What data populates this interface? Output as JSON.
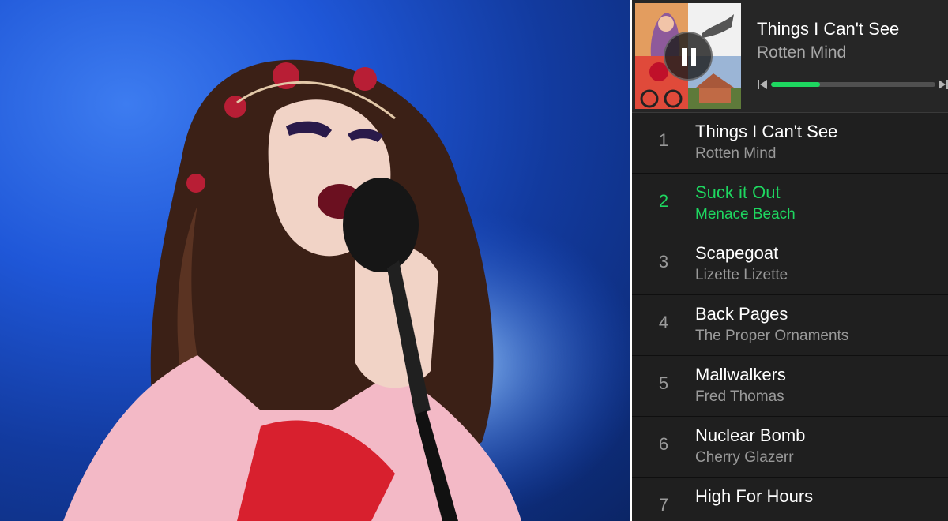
{
  "player": {
    "now_playing": {
      "title": "Things I Can't See",
      "artist": "Rotten Mind"
    },
    "progress": 0.3,
    "accent_color": "#1ed760",
    "controls": [
      "pause-icon",
      "previous-icon",
      "next-icon"
    ]
  },
  "playlist": [
    {
      "number": "1",
      "title": "Things I Can't See",
      "artist": "Rotten Mind",
      "active": false
    },
    {
      "number": "2",
      "title": "Suck it Out",
      "artist": "Menace Beach",
      "active": true
    },
    {
      "number": "3",
      "title": "Scapegoat",
      "artist": "Lizette Lizette",
      "active": false
    },
    {
      "number": "4",
      "title": "Back Pages",
      "artist": "The Proper Ornaments",
      "active": false
    },
    {
      "number": "5",
      "title": "Mallwalkers",
      "artist": "Fred Thomas",
      "active": false
    },
    {
      "number": "6",
      "title": "Nuclear Bomb",
      "artist": "Cherry Glazerr",
      "active": false
    },
    {
      "number": "7",
      "title": "High For Hours",
      "artist": "",
      "active": false
    }
  ]
}
